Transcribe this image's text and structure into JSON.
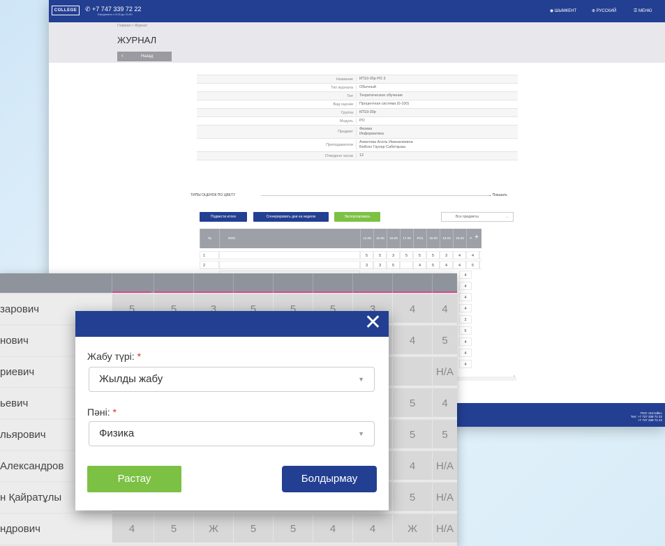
{
  "header": {
    "logo": "COLLEGE",
    "phone": "+7 747 339 72 22",
    "phone_note": "Ежедневно с 9:00 до 21:00",
    "nav": [
      {
        "label": "ШЫМКЕНТ",
        "icon": "location-pin-icon"
      },
      {
        "label": "РУССКИЙ",
        "icon": "globe-icon"
      },
      {
        "label": "МЕНЮ",
        "icon": "menu-icon"
      }
    ]
  },
  "subheader": {
    "breadcrumb": "Главная  >  Журнал",
    "title": "ЖУРНАЛ",
    "back": "Назад"
  },
  "info": [
    {
      "k": "Название",
      "v": "КП19-30р РО 3"
    },
    {
      "k": "Тип журнала",
      "v": "Обычный"
    },
    {
      "k": "Тип",
      "v": "Теоретическое обучение"
    },
    {
      "k": "Вид оценки",
      "v": "Процентная система (0-100)"
    },
    {
      "k": "Группа",
      "v": "КП19-30р"
    },
    {
      "k": "Модуль",
      "v": "РО"
    },
    {
      "k": "Предмет",
      "v": "Физика\nИнформатика"
    },
    {
      "k": "Преподаватели",
      "v": "Ахметова Асель Иманалиевна\nБейсен Гаухар Сабитқызы"
    },
    {
      "k": "Отведено часов",
      "v": "12"
    }
  ],
  "color_types": {
    "label": "ТИПЫ ОЦЕНОК ПО ЦВЕТУ",
    "show": "Показать"
  },
  "actions": {
    "summarize": "Подвести итоги",
    "generate": "Сгенерировать дни на неделю",
    "export": "Экспортировать",
    "filter": "Все предметы"
  },
  "table": {
    "headers": [
      "№",
      "ФИО",
      "14.09",
      "15.09",
      "16.09",
      "17.09",
      "РО1",
      "18.09",
      "19.09",
      "20.09",
      "РО2",
      "Экзамен 21.09"
    ],
    "plus": "+",
    "rows": [
      {
        "n": "1",
        "vals": [
          "5",
          "5",
          "3",
          "5",
          "5",
          "5",
          "3",
          "4",
          "4",
          "4"
        ]
      },
      {
        "n": "2",
        "vals": [
          "3",
          "3",
          "5",
          "",
          "4",
          "5",
          "4",
          "4",
          "5",
          "4"
        ]
      }
    ],
    "extra_col": [
      "4",
      "4",
      "4",
      "4",
      "2",
      "5",
      "4",
      "4",
      "4"
    ]
  },
  "footer": {
    "company": "ТОО «InCrafts»",
    "tel": "Тел: +7 727 339 72 22",
    "tel2": "+7 747 339 72 22"
  },
  "zoom": {
    "rows": [
      {
        "name": "зарович",
        "vals": [
          "5",
          "5",
          "3",
          "5",
          "5",
          "5",
          "3",
          "4",
          "4"
        ]
      },
      {
        "name": "нович",
        "vals": [
          "",
          "",
          "",
          "",
          "",
          "",
          "",
          "4",
          "5"
        ]
      },
      {
        "name": "риевич",
        "vals": [
          "",
          "",
          "",
          "",
          "",
          "",
          "",
          "",
          "Н/А"
        ]
      },
      {
        "name": "ьевич",
        "vals": [
          "",
          "",
          "",
          "",
          "",
          "",
          "",
          "5",
          "4"
        ]
      },
      {
        "name": "льярович",
        "vals": [
          "",
          "",
          "",
          "",
          "",
          "",
          "",
          "5",
          "5"
        ]
      },
      {
        "name": " Александров",
        "vals": [
          "",
          "",
          "",
          "",
          "",
          "",
          "",
          "4",
          "Н/А"
        ]
      },
      {
        "name": "н Қайратұлы",
        "vals": [
          "",
          "",
          "",
          "",
          "",
          "",
          "",
          "5",
          "Н/А"
        ]
      },
      {
        "name": "ндрович",
        "vals": [
          "4",
          "5",
          "Ж",
          "5",
          "5",
          "4",
          "4",
          "Ж",
          "Н/А"
        ]
      }
    ]
  },
  "modal": {
    "close": "✕",
    "type_label": "Жабу түрі:",
    "type_value": "Жылды жабу",
    "subject_label": "Пәні:",
    "subject_value": "Физика",
    "required": "*",
    "confirm": "Растау",
    "cancel": "Болдырмау"
  }
}
